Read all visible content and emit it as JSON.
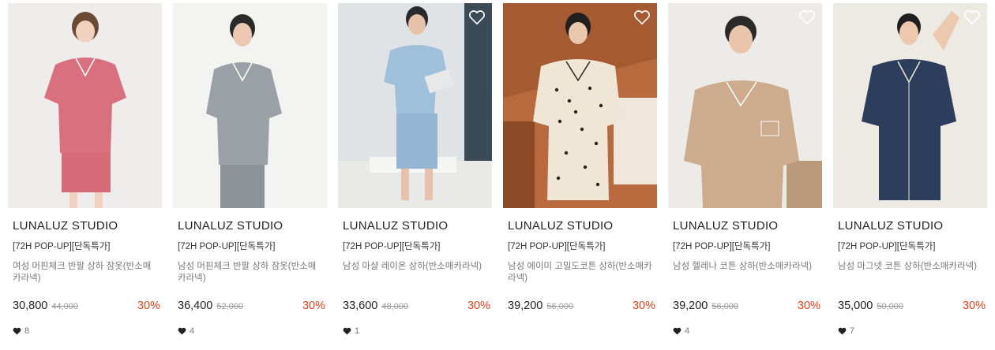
{
  "products": [
    {
      "brand": "LUNALUZ STUDIO",
      "promo": "[72H POP-UP][단독특가]",
      "name": "여성 머핀체크 반팔 상하 잠옷(반소매카라넥)",
      "price": "30,800",
      "original_price": "44,000",
      "discount": "30%",
      "likes": "8",
      "wishlist_icon": "heart-outline-icon",
      "image": "woman-pink-gingham-pajamas"
    },
    {
      "brand": "LUNALUZ STUDIO",
      "promo": "[72H POP-UP][단독특가]",
      "name": "남성 머핀체크 반팔 상하 잠옷(반소매카라넥)",
      "price": "36,400",
      "original_price": "52,000",
      "discount": "30%",
      "likes": "4",
      "wishlist_icon": "heart-outline-icon",
      "image": "man-grey-check-pajamas"
    },
    {
      "brand": "LUNALUZ STUDIO",
      "promo": "[72H POP-UP][단독특가]",
      "name": "남성 마샬 레이온 상하(반소매카라넥)",
      "price": "33,600",
      "original_price": "48,000",
      "discount": "30%",
      "likes": "1",
      "wishlist_icon": "heart-outline-icon",
      "image": "man-blue-check-pajamas-reading"
    },
    {
      "brand": "LUNALUZ STUDIO",
      "promo": "[72H POP-UP][단독특가]",
      "name": "남성 에이미 고밀도코튼 상하(반소매카라넥)",
      "price": "39,200",
      "original_price": "56,000",
      "discount": "30%",
      "likes": "",
      "wishlist_icon": "heart-outline-icon",
      "image": "man-polka-dot-pajamas"
    },
    {
      "brand": "LUNALUZ STUDIO",
      "promo": "[72H POP-UP][단독특가]",
      "name": "남성 헬레나 코튼 상하(반소매카라넥)",
      "price": "39,200",
      "original_price": "56,000",
      "discount": "30%",
      "likes": "4",
      "wishlist_icon": "heart-outline-icon",
      "image": "man-beige-pajamas"
    },
    {
      "brand": "LUNALUZ STUDIO",
      "promo": "[72H POP-UP][단독특가]",
      "name": "남성 마그넷 코튼 상하(반소매카라넥)",
      "price": "35,000",
      "original_price": "50,000",
      "discount": "30%",
      "likes": "7",
      "wishlist_icon": "heart-outline-icon",
      "image": "man-navy-pajamas"
    }
  ],
  "colors": {
    "discount": "#e8401c",
    "text": "#222222",
    "muted": "#777777"
  }
}
